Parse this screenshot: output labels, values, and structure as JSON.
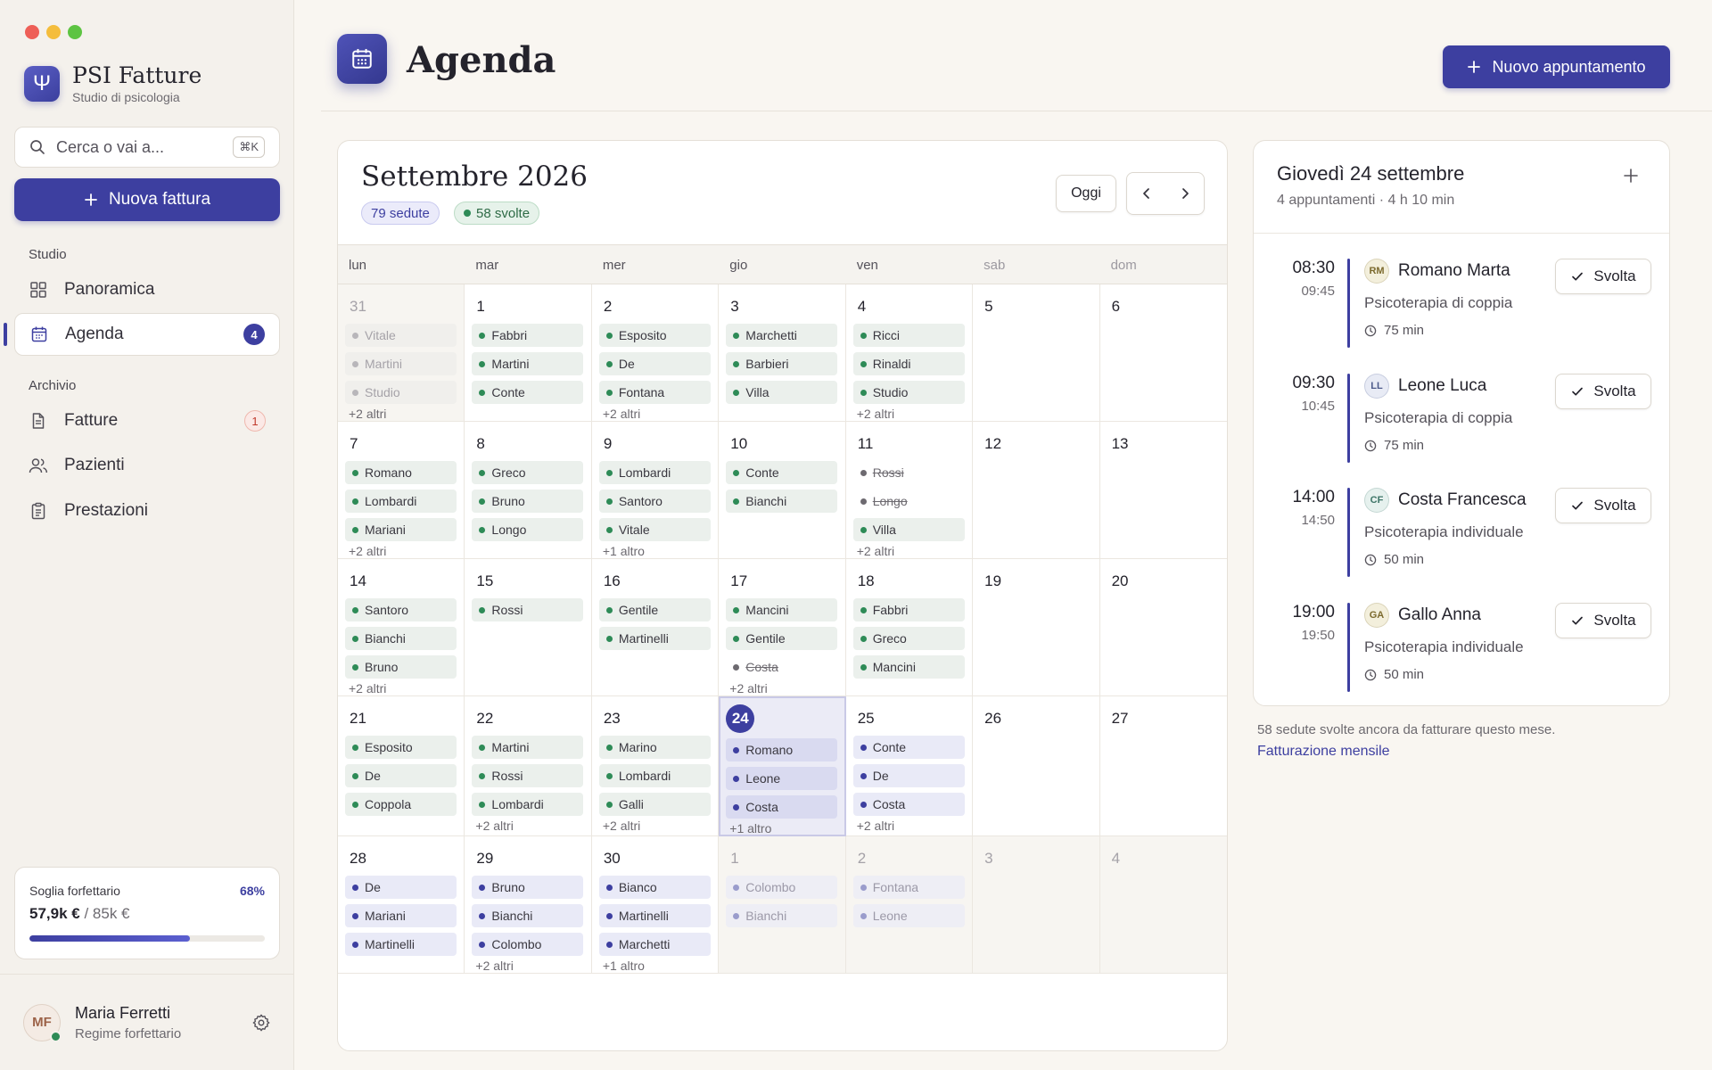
{
  "app": {
    "name": "PSI Fatture",
    "subtitle": "Studio di psicologia",
    "logo_glyph": "Ψ"
  },
  "search": {
    "placeholder": "Cerca o vai a...",
    "shortcut": "⌘K"
  },
  "new_invoice_label": "Nuova fattura",
  "nav": {
    "section_studio": "Studio",
    "section_archive": "Archivio",
    "overview": "Panoramica",
    "agenda": "Agenda",
    "agenda_badge": "4",
    "invoices": "Fatture",
    "invoices_badge": "1",
    "patients": "Pazienti",
    "services": "Prestazioni"
  },
  "threshold": {
    "label": "Soglia forfettario",
    "percent": "68%",
    "value": "57,9k €",
    "limit": "/ 85k €",
    "fill": 0.68
  },
  "user": {
    "initials": "MF",
    "name": "Maria Ferretti",
    "regime": "Regime forfettario"
  },
  "header": {
    "title": "Agenda",
    "new_appointment": "Nuovo appuntamento"
  },
  "calendar": {
    "month_title": "Settembre 2026",
    "sessions_pill": "79 sedute",
    "done_pill": "58 svolte",
    "today_button": "Oggi",
    "weekdays": [
      "lun",
      "mar",
      "mer",
      "gio",
      "ven",
      "sab",
      "dom"
    ],
    "days": [
      {
        "n": "31",
        "outside": true,
        "events": [
          [
            "Vitale",
            "faded"
          ],
          [
            "Martini",
            "faded"
          ],
          [
            "Studio",
            "faded"
          ]
        ],
        "more": "+2 altri"
      },
      {
        "n": "1",
        "events": [
          [
            "Fabbri",
            "done"
          ],
          [
            "Martini",
            "done"
          ],
          [
            "Conte",
            "done"
          ]
        ]
      },
      {
        "n": "2",
        "events": [
          [
            "Esposito",
            "done"
          ],
          [
            "De",
            "done"
          ],
          [
            "Fontana",
            "done"
          ]
        ],
        "more": "+2 altri"
      },
      {
        "n": "3",
        "events": [
          [
            "Marchetti",
            "done"
          ],
          [
            "Barbieri",
            "done"
          ],
          [
            "Villa",
            "done"
          ]
        ]
      },
      {
        "n": "4",
        "events": [
          [
            "Ricci",
            "done"
          ],
          [
            "Rinaldi",
            "done"
          ],
          [
            "Studio",
            "done"
          ]
        ],
        "more": "+2 altri"
      },
      {
        "n": "5",
        "events": []
      },
      {
        "n": "6",
        "events": []
      },
      {
        "n": "7",
        "events": [
          [
            "Romano",
            "done"
          ],
          [
            "Lombardi",
            "done"
          ],
          [
            "Mariani",
            "done"
          ]
        ],
        "more": "+2 altri"
      },
      {
        "n": "8",
        "events": [
          [
            "Greco",
            "done"
          ],
          [
            "Bruno",
            "done"
          ],
          [
            "Longo",
            "done"
          ]
        ]
      },
      {
        "n": "9",
        "events": [
          [
            "Lombardi",
            "done"
          ],
          [
            "Santoro",
            "done"
          ],
          [
            "Vitale",
            "done"
          ]
        ],
        "more": "+1 altro"
      },
      {
        "n": "10",
        "events": [
          [
            "Conte",
            "done"
          ],
          [
            "Bianchi",
            "done"
          ]
        ]
      },
      {
        "n": "11",
        "events": [
          [
            "Rossi",
            "cancel"
          ],
          [
            "Longo",
            "cancel"
          ],
          [
            "Villa",
            "done"
          ]
        ],
        "more": "+2 altri"
      },
      {
        "n": "12",
        "events": []
      },
      {
        "n": "13",
        "events": []
      },
      {
        "n": "14",
        "events": [
          [
            "Santoro",
            "done"
          ],
          [
            "Bianchi",
            "done"
          ],
          [
            "Bruno",
            "done"
          ]
        ],
        "more": "+2 altri"
      },
      {
        "n": "15",
        "events": [
          [
            "Rossi",
            "done"
          ]
        ]
      },
      {
        "n": "16",
        "events": [
          [
            "Gentile",
            "done"
          ],
          [
            "Martinelli",
            "done"
          ]
        ]
      },
      {
        "n": "17",
        "events": [
          [
            "Mancini",
            "done"
          ],
          [
            "Gentile",
            "done"
          ],
          [
            "Costa",
            "cancel"
          ]
        ],
        "more": "+2 altri"
      },
      {
        "n": "18",
        "events": [
          [
            "Fabbri",
            "done"
          ],
          [
            "Greco",
            "done"
          ],
          [
            "Mancini",
            "done"
          ]
        ]
      },
      {
        "n": "19",
        "events": []
      },
      {
        "n": "20",
        "events": []
      },
      {
        "n": "21",
        "events": [
          [
            "Esposito",
            "done"
          ],
          [
            "De",
            "done"
          ],
          [
            "Coppola",
            "done"
          ]
        ]
      },
      {
        "n": "22",
        "events": [
          [
            "Martini",
            "done"
          ],
          [
            "Rossi",
            "done"
          ],
          [
            "Lombardi",
            "done"
          ]
        ],
        "more": "+2 altri"
      },
      {
        "n": "23",
        "events": [
          [
            "Marino",
            "done"
          ],
          [
            "Lombardi",
            "done"
          ],
          [
            "Galli",
            "done"
          ]
        ],
        "more": "+2 altri"
      },
      {
        "n": "24",
        "today": true,
        "events": [
          [
            "Romano",
            "sched"
          ],
          [
            "Leone",
            "sched"
          ],
          [
            "Costa",
            "sched"
          ]
        ],
        "more": "+1 altro"
      },
      {
        "n": "25",
        "events": [
          [
            "Conte",
            "sched"
          ],
          [
            "De",
            "sched"
          ],
          [
            "Costa",
            "sched"
          ]
        ],
        "more": "+2 altri"
      },
      {
        "n": "26",
        "events": []
      },
      {
        "n": "27",
        "events": []
      },
      {
        "n": "28",
        "events": [
          [
            "De",
            "sched"
          ],
          [
            "Mariani",
            "sched"
          ],
          [
            "Martinelli",
            "sched"
          ]
        ]
      },
      {
        "n": "29",
        "events": [
          [
            "Bruno",
            "sched"
          ],
          [
            "Bianchi",
            "sched"
          ],
          [
            "Colombo",
            "sched"
          ]
        ],
        "more": "+2 altri"
      },
      {
        "n": "30",
        "events": [
          [
            "Bianco",
            "sched"
          ],
          [
            "Martinelli",
            "sched"
          ],
          [
            "Marchetti",
            "sched"
          ]
        ],
        "more": "+1 altro"
      },
      {
        "n": "1",
        "outside": true,
        "events": [
          [
            "Colombo",
            "sched"
          ],
          [
            "Bianchi",
            "sched"
          ]
        ]
      },
      {
        "n": "2",
        "outside": true,
        "events": [
          [
            "Fontana",
            "sched"
          ],
          [
            "Leone",
            "sched"
          ]
        ]
      },
      {
        "n": "3",
        "outside": true,
        "events": []
      },
      {
        "n": "4",
        "outside": true,
        "events": []
      }
    ]
  },
  "day_panel": {
    "title": "Giovedì 24 settembre",
    "summary": "4 appuntamenti · 4 h 10 min",
    "done_label": "Svolta",
    "appointments": [
      {
        "start": "08:30",
        "end": "09:45",
        "initials": "RM",
        "name": "Romano Marta",
        "type": "Psicoterapia di coppia",
        "duration": "75 min",
        "ini_bg": "#f3efdc",
        "ini_fg": "#7c6a2e"
      },
      {
        "start": "09:30",
        "end": "10:45",
        "initials": "LL",
        "name": "Leone Luca",
        "type": "Psicoterapia di coppia",
        "duration": "75 min",
        "ini_bg": "#e8ebf5",
        "ini_fg": "#4d5a8a"
      },
      {
        "start": "14:00",
        "end": "14:50",
        "initials": "CF",
        "name": "Costa Francesca",
        "type": "Psicoterapia individuale",
        "duration": "50 min",
        "ini_bg": "#e6f1ee",
        "ini_fg": "#3d7567"
      },
      {
        "start": "19:00",
        "end": "19:50",
        "initials": "GA",
        "name": "Gallo Anna",
        "type": "Psicoterapia individuale",
        "duration": "50 min",
        "ini_bg": "#f3efdc",
        "ini_fg": "#7c6a2e"
      }
    ]
  },
  "footer_note": {
    "text": "58 sedute svolte ancora da fatturare questo mese.",
    "link": "Fatturazione mensile"
  },
  "colors": {
    "accent": "#3d3fa0",
    "done": "#2e8b57",
    "danger": "#c0392b"
  }
}
